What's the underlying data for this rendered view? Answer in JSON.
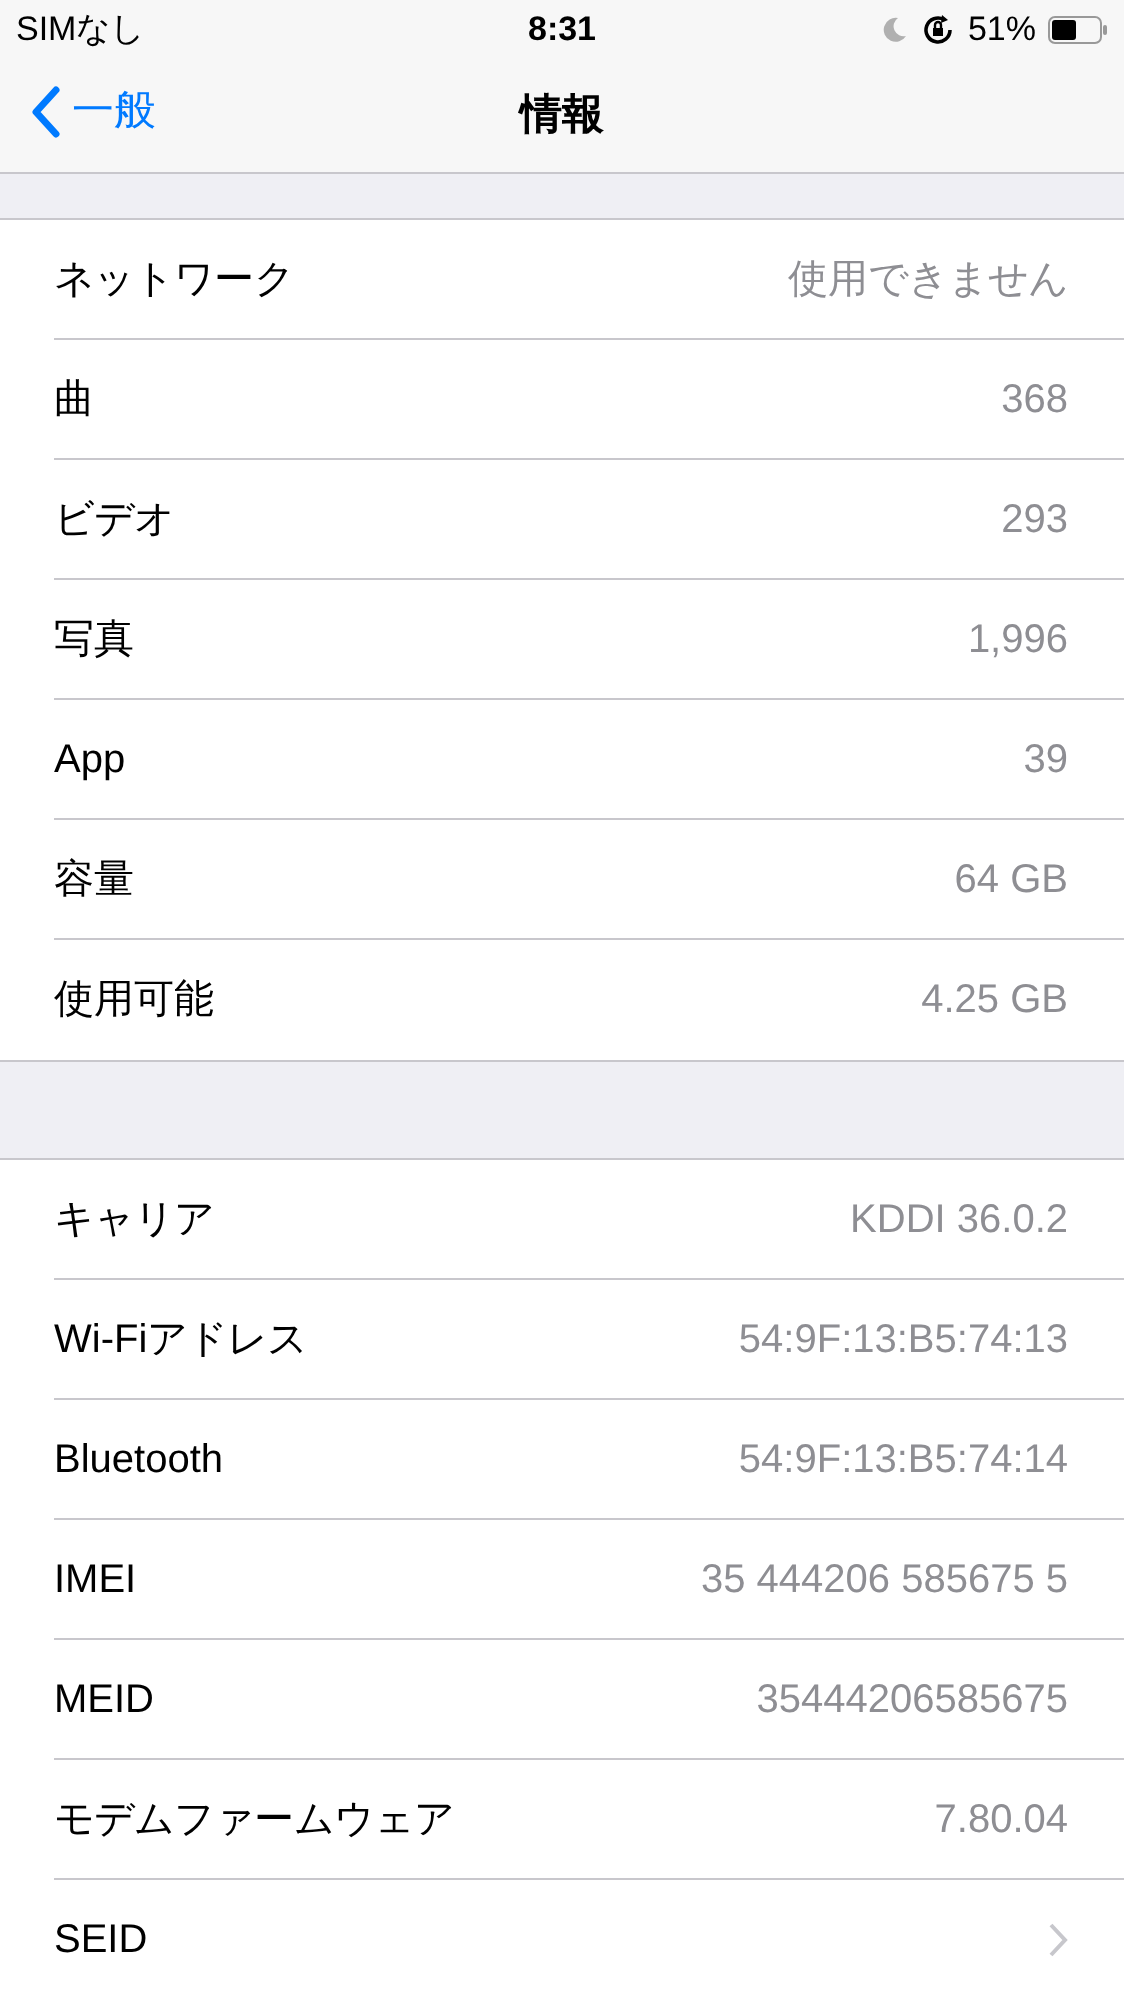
{
  "status_bar": {
    "carrier": "SIMなし",
    "time": "8:31",
    "battery": "51%"
  },
  "nav": {
    "back": "一般",
    "title": "情報"
  },
  "sections": [
    {
      "rows": [
        {
          "kind": "value",
          "label": "ネットワーク",
          "value": "使用できません"
        },
        {
          "kind": "value",
          "label": "曲",
          "value": "368"
        },
        {
          "kind": "value",
          "label": "ビデオ",
          "value": "293"
        },
        {
          "kind": "value",
          "label": "写真",
          "value": "1,996"
        },
        {
          "kind": "value",
          "label": "App",
          "value": "39"
        },
        {
          "kind": "value",
          "label": "容量",
          "value": "64 GB"
        },
        {
          "kind": "value",
          "label": "使用可能",
          "value": "4.25 GB"
        }
      ]
    },
    {
      "rows": [
        {
          "kind": "value",
          "label": "キャリア",
          "value": "KDDI 36.0.2"
        },
        {
          "kind": "value",
          "label": "Wi-Fiアドレス",
          "value": "54:9F:13:B5:74:13"
        },
        {
          "kind": "value",
          "label": "Bluetooth",
          "value": "54:9F:13:B5:74:14"
        },
        {
          "kind": "value",
          "label": "IMEI",
          "value": "35 444206 585675 5"
        },
        {
          "kind": "value",
          "label": "MEID",
          "value": "35444206585675"
        },
        {
          "kind": "value",
          "label": "モデムファームウェア",
          "value": "7.80.04"
        },
        {
          "kind": "link",
          "label": "SEID"
        }
      ]
    }
  ]
}
